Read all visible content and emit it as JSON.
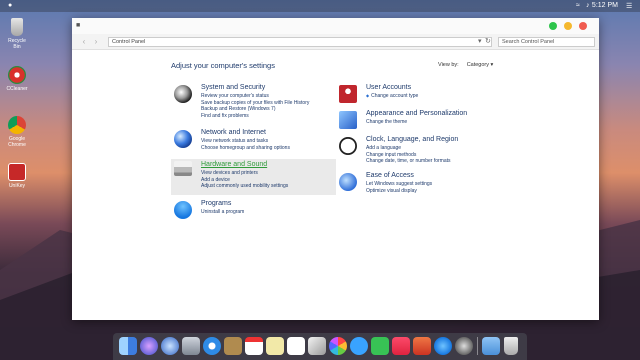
{
  "menubar": {
    "clock": "5:12 PM"
  },
  "desktop": {
    "icons": [
      {
        "label": "Recycle Bin"
      },
      {
        "label": "CCleaner"
      },
      {
        "label": "Google Chrome"
      },
      {
        "label": "UniKey"
      }
    ]
  },
  "window": {
    "address": "Control Panel",
    "search_placeholder": "Search Control Panel",
    "heading": "Adjust your computer's settings",
    "view_by_label": "View by:",
    "view_by_value": "Category ▾",
    "categories_left": [
      {
        "title": "System and Security",
        "links": [
          "Review your computer's status",
          "Save backup copies of your files with File History",
          "Backup and Restore (Windows 7)",
          "Find and fix problems"
        ]
      },
      {
        "title": "Network and Internet",
        "links": [
          "View network status and tasks",
          "Choose homegroup and sharing options"
        ]
      },
      {
        "title": "Hardware and Sound",
        "links": [
          "View devices and printers",
          "Add a device",
          "Adjust commonly used mobility settings"
        ]
      },
      {
        "title": "Programs",
        "links": [
          "Uninstall a program"
        ]
      }
    ],
    "categories_right": [
      {
        "title": "User Accounts",
        "links": [
          "Change account type"
        ]
      },
      {
        "title": "Appearance and Personalization",
        "links": [
          "Change the theme"
        ]
      },
      {
        "title": "Clock, Language, and Region",
        "links": [
          "Add a language",
          "Change input methods",
          "Change date, time, or number formats"
        ]
      },
      {
        "title": "Ease of Access",
        "links": [
          "Let Windows suggest settings",
          "Optimize visual display"
        ]
      }
    ]
  },
  "colors": {
    "link": "#1e3a6b",
    "hover_title": "#2f9b3a",
    "traffic_green": "#2dc44b",
    "traffic_yellow": "#f5b82e",
    "traffic_red": "#f05b50"
  }
}
